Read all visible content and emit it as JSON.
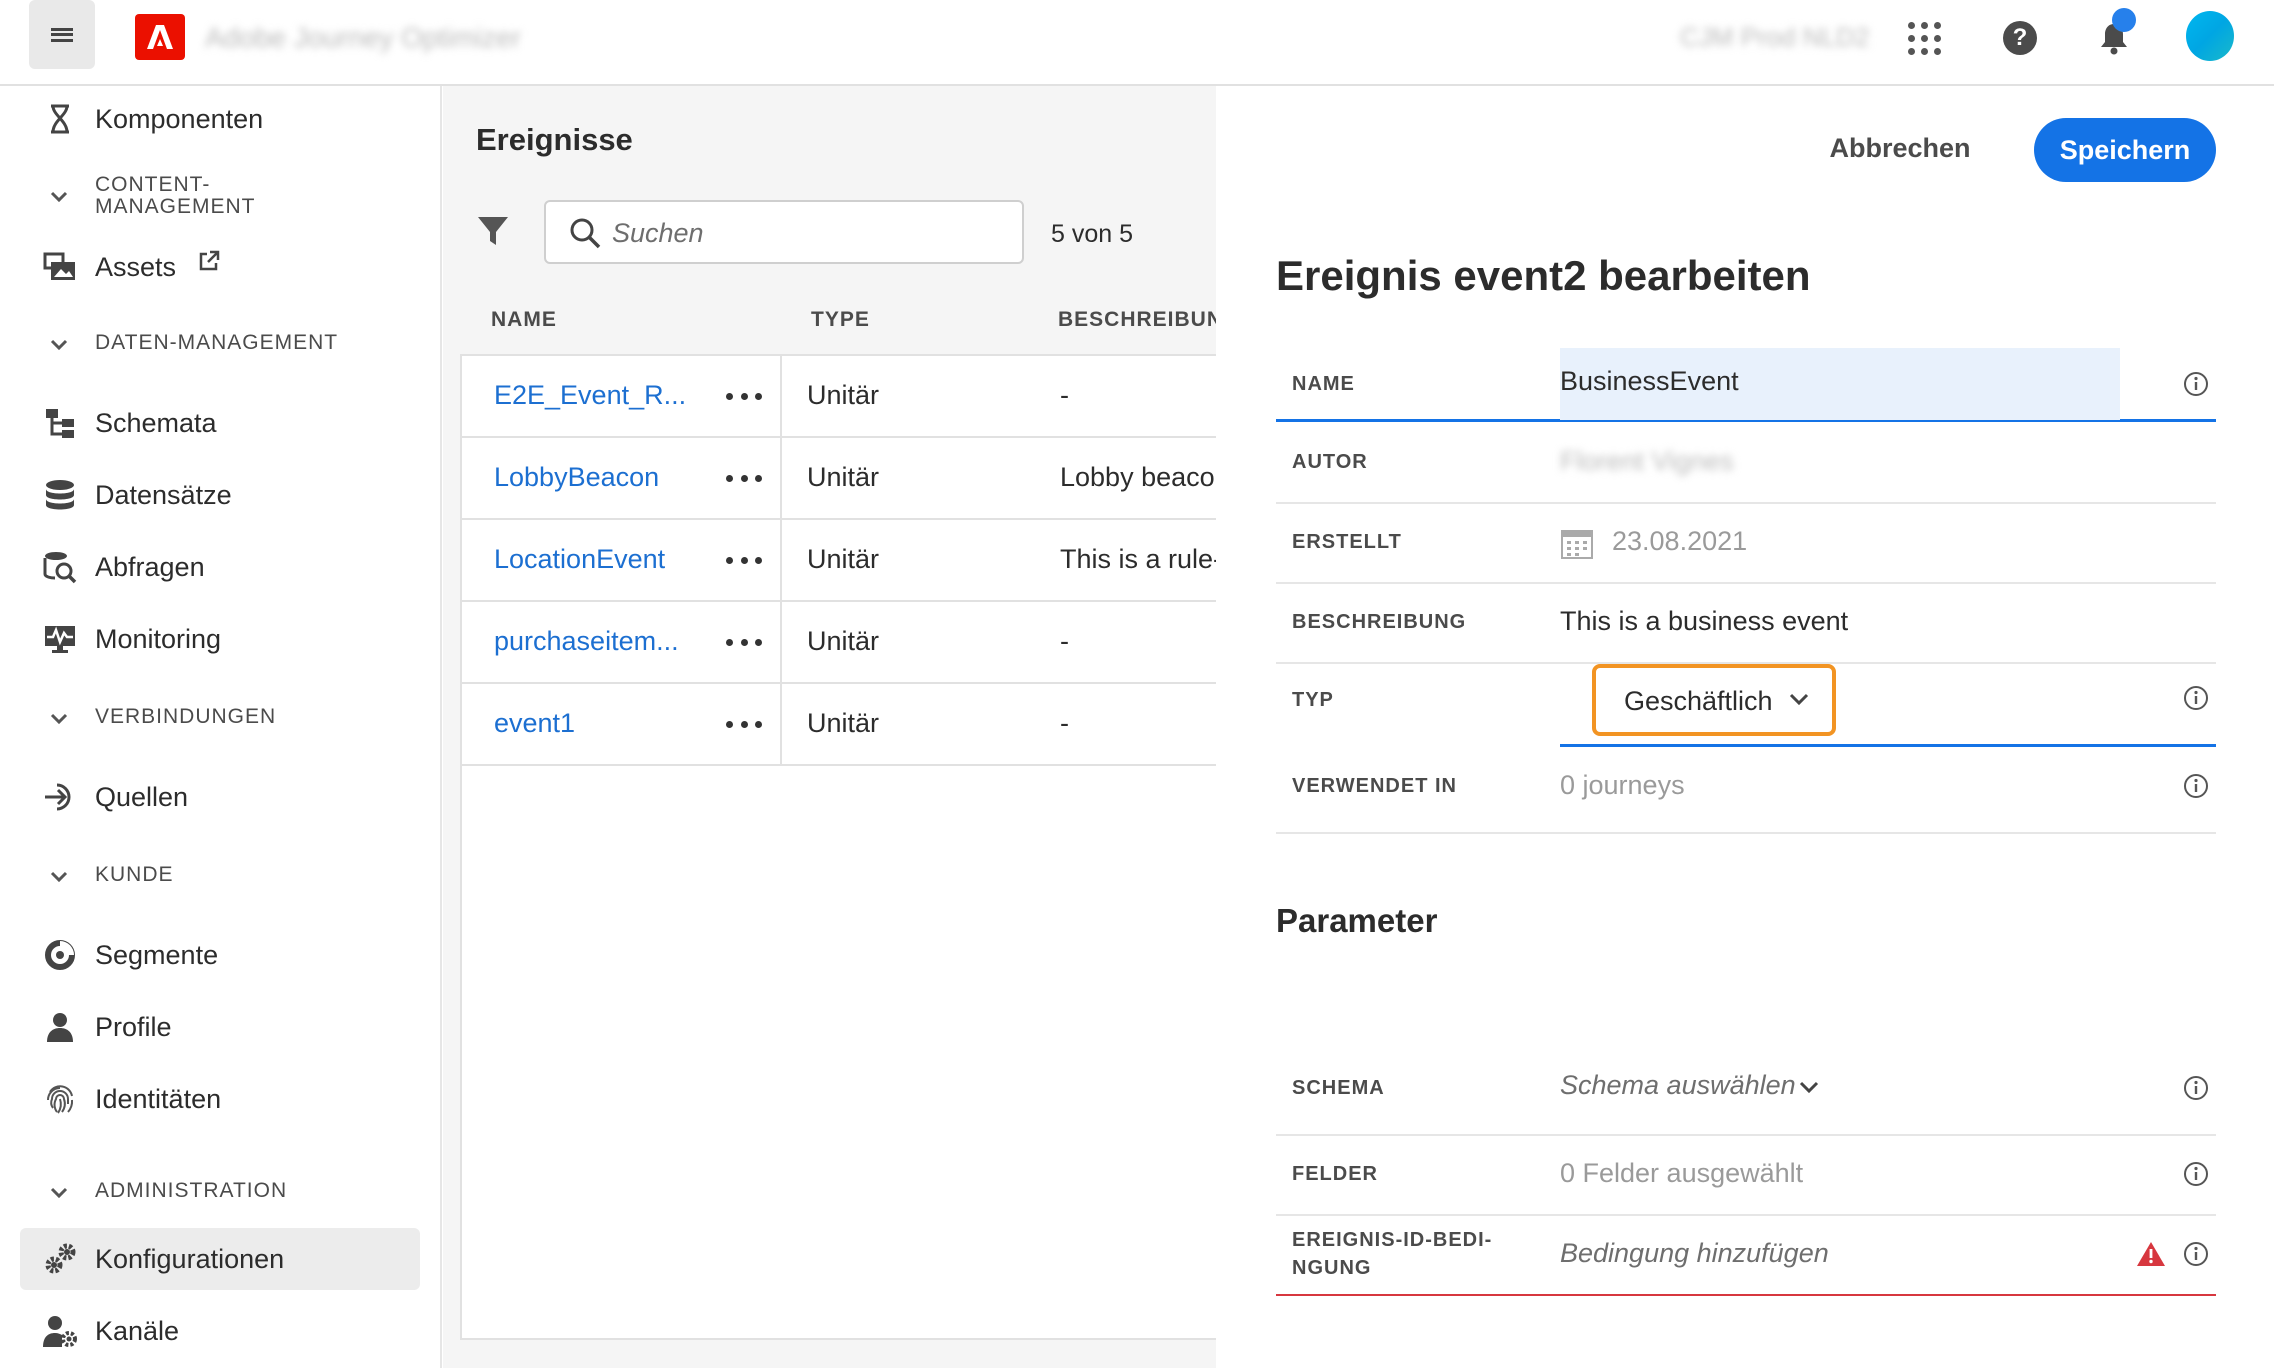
{
  "topbar": {
    "app_title": "Adobe Journey Optimizer",
    "org_name": "CJM Prod NLD2",
    "icons": [
      "menu-icon",
      "adobe-logo",
      "apps-icon",
      "help-icon",
      "bell-icon",
      "avatar"
    ],
    "accent": "#1473e6",
    "logo_color": "#eb1000"
  },
  "sidebar": {
    "items": [
      {
        "label": "Komponenten",
        "icon": "components-icon"
      },
      {
        "section": "CONTENT-\nMANAGEMENT"
      },
      {
        "label": "Assets",
        "icon": "assets-icon",
        "external": true
      },
      {
        "section": "DATEN-MANAGEMENT"
      },
      {
        "label": "Schemata",
        "icon": "schema-icon"
      },
      {
        "label": "Datensätze",
        "icon": "datasets-icon"
      },
      {
        "label": "Abfragen",
        "icon": "queries-icon"
      },
      {
        "label": "Monitoring",
        "icon": "monitoring-icon"
      },
      {
        "section": "VERBINDUNGEN"
      },
      {
        "label": "Quellen",
        "icon": "sources-icon"
      },
      {
        "section": "KUNDE"
      },
      {
        "label": "Segmente",
        "icon": "segments-icon"
      },
      {
        "label": "Profile",
        "icon": "profile-icon"
      },
      {
        "label": "Identitäten",
        "icon": "fingerprint-icon"
      },
      {
        "section": "ADMINISTRATION"
      },
      {
        "label": "Konfigurationen",
        "icon": "gears-icon",
        "active": true
      },
      {
        "label": "Kanäle",
        "icon": "channels-icon"
      }
    ]
  },
  "events": {
    "title": "Ereignisse",
    "search_placeholder": "Suchen",
    "count": "5 von 5",
    "columns": [
      "NAME",
      "TYPE",
      "BESCHREIBUNG"
    ],
    "rows": [
      {
        "name": "E2E_Event_R...",
        "type": "Unitär",
        "description": "-"
      },
      {
        "name": "LobbyBeacon",
        "type": "Unitär",
        "description": "Lobby beacon"
      },
      {
        "name": "LocationEvent",
        "type": "Unitär",
        "description": "This is a rule-b"
      },
      {
        "name": "purchaseitem...",
        "type": "Unitär",
        "description": "-"
      },
      {
        "name": "event1",
        "type": "Unitär",
        "description": "-"
      }
    ]
  },
  "panel": {
    "cancel": "Abbrechen",
    "save": "Speichern",
    "title": "Ereignis event2 bearbeiten",
    "fields": {
      "name_label": "NAME",
      "name_value": "BusinessEvent",
      "author_label": "AUTOR",
      "author_value": "Florent Vignes",
      "created_label": "ERSTELLT",
      "created_value": "23.08.2021",
      "description_label": "BESCHREIBUNG",
      "description_value": "This is a business event",
      "type_label": "TYP",
      "type_value": "Geschäftlich",
      "used_label": "VERWENDET IN",
      "used_value": "0 journeys"
    },
    "params": {
      "title": "Parameter",
      "schema_label": "SCHEMA",
      "schema_value": "Schema auswählen",
      "fields_label": "FELDER",
      "fields_value": "0 Felder ausgewählt",
      "condition_label": "EREIGNIS-ID-BEDI-\nNGUNG",
      "condition_value": "Bedingung hinzufügen"
    },
    "highlight_color": "#f29423",
    "error_color": "#d7373f"
  }
}
